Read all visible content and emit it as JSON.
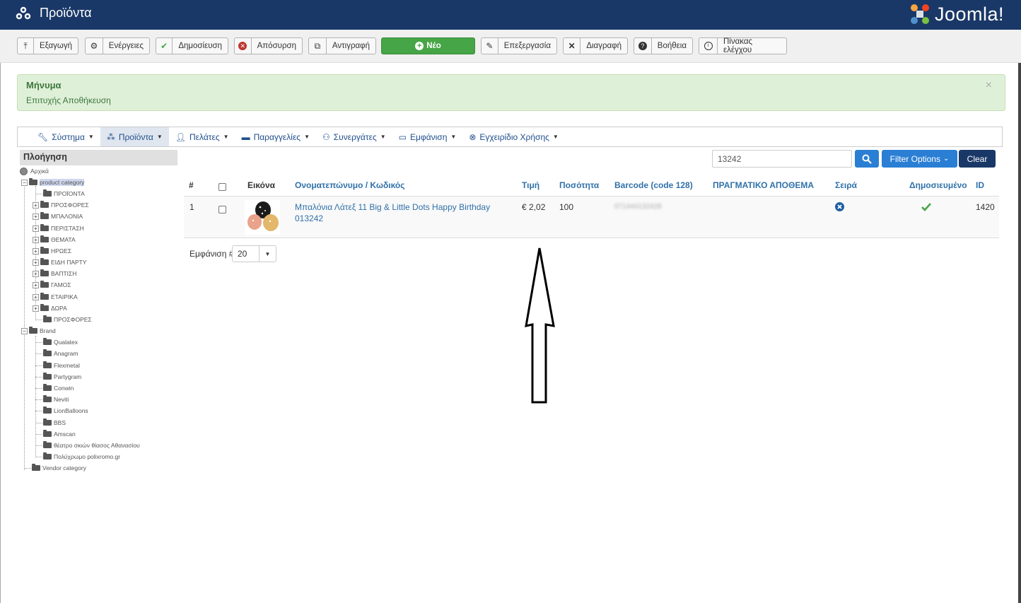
{
  "header": {
    "title": "Προϊόντα",
    "logo_text": "Joomla!",
    "bg_color": "#1a3867"
  },
  "toolbar": {
    "export": "Εξαγωγή",
    "actions": "Ενέργειες",
    "publish": "Δημοσίευση",
    "unpublish": "Απόσυρση",
    "copy": "Αντιγραφή",
    "new": "Νέο",
    "edit": "Επεξεργασία",
    "delete": "Διαγραφή",
    "help": "Βοήθεια",
    "control_panel": "Πίνακας ελέγχου"
  },
  "alert": {
    "title": "Μήνυμα",
    "message": "Επιτυχής Αποθήκευση",
    "close": "×"
  },
  "nav": {
    "items": [
      {
        "label": "Σύστημα",
        "icon": "wrench-icon"
      },
      {
        "label": "Προϊόντα",
        "icon": "cubes-icon"
      },
      {
        "label": "Πελάτες",
        "icon": "user-icon"
      },
      {
        "label": "Παραγγελίες",
        "icon": "card-icon"
      },
      {
        "label": "Συνεργάτες",
        "icon": "users-icon"
      },
      {
        "label": "Εμφάνιση",
        "icon": "monitor-icon"
      },
      {
        "label": "Εγχειρίδιο Χρήσης",
        "icon": "lifebuoy-icon"
      }
    ]
  },
  "tree": {
    "heading": "Πλοήγηση",
    "root": "Αρχικά",
    "product_category": "product category",
    "categories": [
      "ΠΡΟΪΟΝΤΑ",
      "ΠΡΟΣΦΟΡΕΣ",
      "ΜΠΑΛΟΝΙΑ",
      "ΠΕΡΙΣΤΑΣΗ",
      "ΘΕΜΑΤΑ",
      "ΗΡΩΕΣ",
      "ΕΙΔΗ ΠΑΡΤΥ",
      "ΒΑΠΤΙΣΗ",
      "ΓΑΜΟΣ",
      "ΕΤΑΙΡΙΚΑ",
      "ΔΩΡΑ",
      "ΠΡΟΣΦΟΡΕΣ"
    ],
    "brand": "Brand",
    "brands": [
      "Qualatex",
      "Anagram",
      "Flexmetal",
      "Partygram",
      "Conwin",
      "Neviti",
      "LionBalloons",
      "BBS",
      "Amscan",
      "θέατρο σκιών θίασος Αθανασίου",
      "Πολύχρωμο polixromo.gr"
    ],
    "vendor_category": "Vendor category"
  },
  "search": {
    "value": "13242",
    "filter_options": "Filter Options",
    "clear": "Clear"
  },
  "table": {
    "headers": {
      "num": "#",
      "image": "Εικόνα",
      "name": "Ονοματεπώνυμο / Κωδικός",
      "price": "Τιμή",
      "quantity": "Ποσότητα",
      "barcode": "Barcode (code 128)",
      "stock": "ΠΡΑΓΜΑΤΙΚΟ ΑΠΟΘΕΜΑ",
      "order": "Σειρά",
      "published": "Δημοσιευμένο",
      "id": "ID"
    },
    "rows": [
      {
        "num": "1",
        "name_line1": "Μπαλόνια Λάτεξ 11 Big & Little Dots Happy Birthday",
        "name_line2": "013242",
        "price": "€ 2,02",
        "quantity": "100",
        "barcode": "071444132428",
        "id": "1420"
      }
    ]
  },
  "pagination": {
    "label": "Εμφάνιση #",
    "value": "20"
  }
}
